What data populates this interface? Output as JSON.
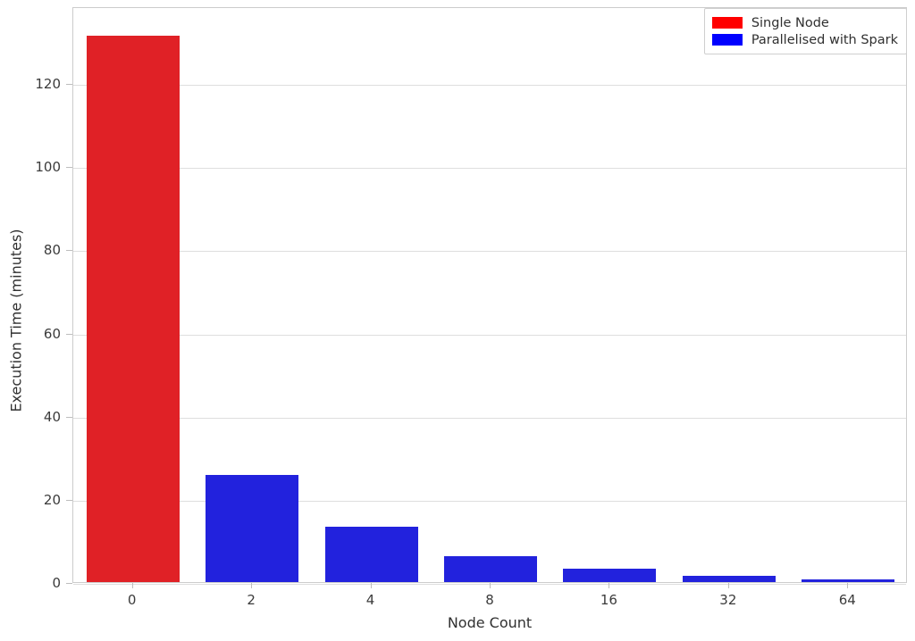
{
  "chart_data": {
    "type": "bar",
    "title": "",
    "xlabel": "Node Count",
    "ylabel": "Execution Time (minutes)",
    "categories": [
      "0",
      "2",
      "4",
      "8",
      "16",
      "32",
      "64"
    ],
    "values": [
      131.5,
      25.7,
      13.3,
      6.2,
      3.2,
      1.6,
      0.7
    ],
    "series": [
      {
        "name": "Single Node",
        "color": "#e02126",
        "legend_color": "#ff0000",
        "categories": [
          "0"
        ],
        "values": [
          131.5
        ]
      },
      {
        "name": "Parallelised with Spark",
        "color": "#2222dd",
        "legend_color": "#0000ff",
        "categories": [
          "2",
          "4",
          "8",
          "16",
          "32",
          "64"
        ],
        "values": [
          25.7,
          13.3,
          6.2,
          3.2,
          1.6,
          0.7
        ]
      }
    ],
    "bar_series_map": [
      "Single Node",
      "Parallelised with Spark",
      "Parallelised with Spark",
      "Parallelised with Spark",
      "Parallelised with Spark",
      "Parallelised with Spark",
      "Parallelised with Spark"
    ],
    "ylim": [
      0,
      138.5
    ],
    "xlim": [
      -0.5,
      6.5
    ],
    "yticks": [
      0,
      20,
      40,
      60,
      80,
      100,
      120
    ],
    "ytick_labels": [
      "0",
      "20",
      "40",
      "60",
      "80",
      "100",
      "120"
    ],
    "grid": true,
    "grid_axis": "y",
    "legend_position": "upper right",
    "legend": [
      "Single Node",
      "Parallelised with Spark"
    ]
  },
  "axes": {
    "xlabel": "Node Count",
    "ylabel": "Execution Time (minutes)"
  },
  "legend": {
    "items": [
      {
        "label": "Single Node",
        "color": "#ff0000"
      },
      {
        "label": "Parallelised with Spark",
        "color": "#0000ff"
      }
    ]
  }
}
